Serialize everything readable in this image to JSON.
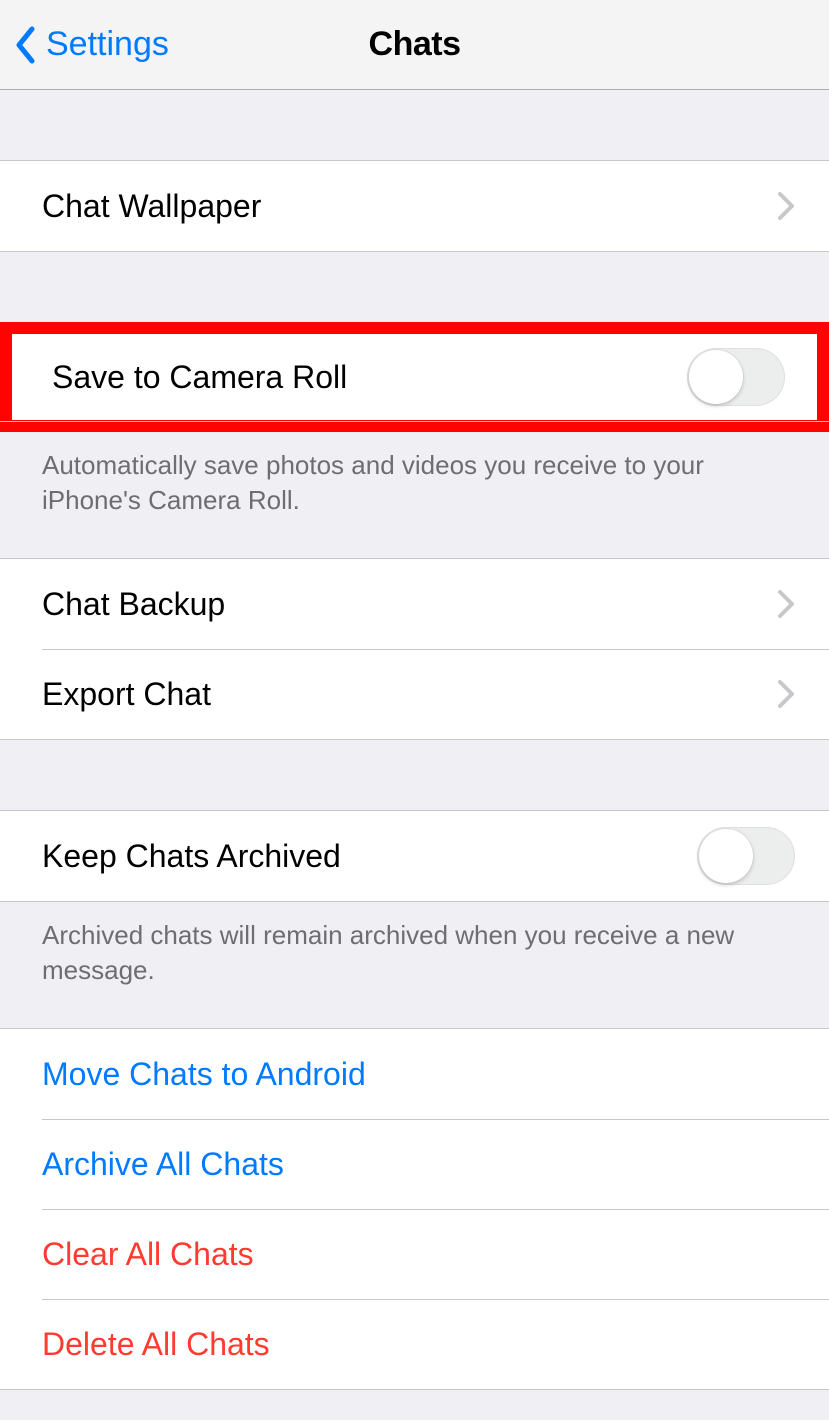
{
  "nav": {
    "back_label": "Settings",
    "title": "Chats"
  },
  "row_wallpaper": "Chat Wallpaper",
  "row_save_camera": "Save to Camera Roll",
  "footer_save_camera": "Automatically save photos and videos you receive to your iPhone's Camera Roll.",
  "row_backup": "Chat Backup",
  "row_export": "Export Chat",
  "row_keep_archived": "Keep Chats Archived",
  "footer_keep_archived": "Archived chats will remain archived when you receive a new message.",
  "action_move_android": "Move Chats to Android",
  "action_archive_all": "Archive All Chats",
  "action_clear_all": "Clear All Chats",
  "action_delete_all": "Delete All Chats",
  "toggles": {
    "save_camera_roll": false,
    "keep_archived": false
  },
  "colors": {
    "accent_blue": "#007aff",
    "destructive_red": "#ff3b30",
    "highlight_box": "#ff0303"
  }
}
